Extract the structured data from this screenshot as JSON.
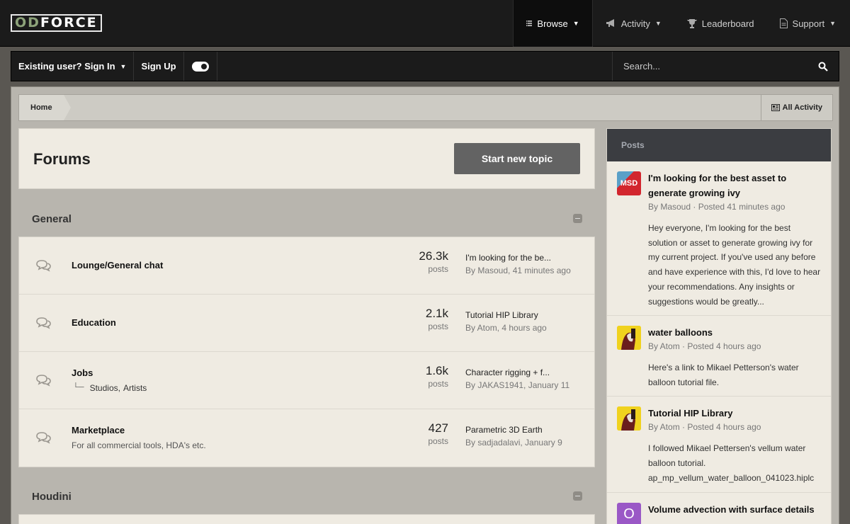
{
  "logo": {
    "od": "OD",
    "force": "FORCE"
  },
  "nav": {
    "browse": "Browse",
    "activity": "Activity",
    "leaderboard": "Leaderboard",
    "support": "Support"
  },
  "userbar": {
    "sign_in": "Existing user? Sign In",
    "sign_up": "Sign Up",
    "search_placeholder": "Search..."
  },
  "breadcrumb": {
    "home": "Home",
    "all_activity": "All Activity"
  },
  "forums": {
    "title": "Forums",
    "new_topic": "Start new topic"
  },
  "categories": [
    {
      "name": "General",
      "forums": [
        {
          "title": "Lounge/General chat",
          "description": "",
          "subforums": [],
          "count": "26.3k",
          "count_label": "posts",
          "last_title": "I'm looking for the be...",
          "last_meta": "By Masoud, 41 minutes ago"
        },
        {
          "title": "Education",
          "description": "",
          "subforums": [],
          "count": "2.1k",
          "count_label": "posts",
          "last_title": "Tutorial HIP Library",
          "last_meta": "By Atom, 4 hours ago"
        },
        {
          "title": "Jobs",
          "description": "",
          "subforums": [
            "Studios,",
            "Artists"
          ],
          "count": "1.6k",
          "count_label": "posts",
          "last_title": "Character rigging + f...",
          "last_meta": "By JAKAS1941, January 11"
        },
        {
          "title": "Marketplace",
          "description": "For all commercial tools, HDA's etc.",
          "subforums": [],
          "count": "427",
          "count_label": "posts",
          "last_title": "Parametric 3D Earth",
          "last_meta": "By sadjadalavi, January 9"
        }
      ]
    },
    {
      "name": "Houdini",
      "forums": []
    }
  ],
  "posts": {
    "heading": "Posts",
    "items": [
      {
        "title": "I'm looking for the best asset to generate growing ivy",
        "meta": "By Masoud · Posted 41 minutes ago",
        "body": "Hey everyone, I'm looking for the best solution or asset to generate growing ivy for my current project. If you've used any before and have experience with this, I'd love to hear your recommendations. Any insights or suggestions would be greatly...",
        "avatar_text": "MSD"
      },
      {
        "title": "water balloons",
        "meta": "By Atom · Posted 4 hours ago",
        "body": "Here's a link to Mikael Petterson's water balloon tutorial file.",
        "avatar_text": ""
      },
      {
        "title": "Tutorial HIP Library",
        "meta": "By Atom · Posted 4 hours ago",
        "body": "I followed Mikael Pettersen's vellum water balloon tutorial. ap_mp_vellum_water_balloon_041023.hiplc",
        "avatar_text": ""
      },
      {
        "title": "Volume advection with surface details",
        "meta": "",
        "body": "",
        "avatar_text": "O"
      }
    ]
  },
  "colors": {
    "accent_dark": "#1b1b1b",
    "content_bg": "#b8b5ae",
    "card_bg": "#efebe2",
    "button": "#636363"
  }
}
